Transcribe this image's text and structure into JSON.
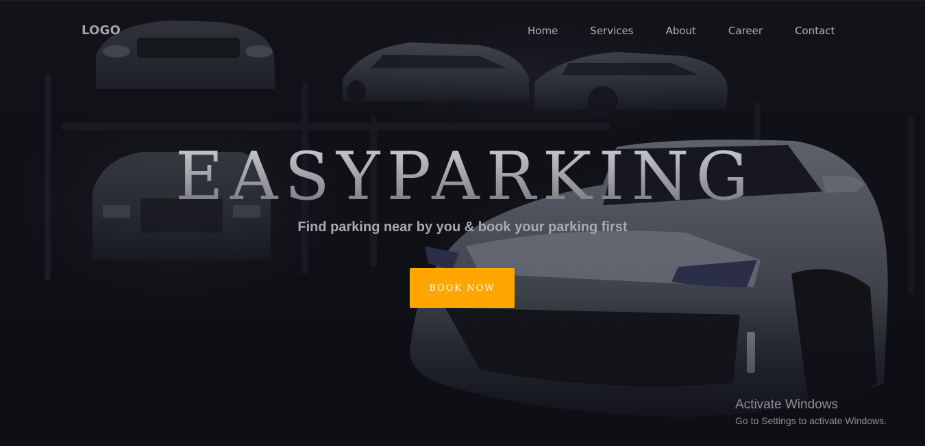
{
  "navbar": {
    "logo": "LOGO",
    "links": [
      {
        "label": "Home"
      },
      {
        "label": "Services"
      },
      {
        "label": "About"
      },
      {
        "label": "Career"
      },
      {
        "label": "Contact"
      }
    ]
  },
  "hero": {
    "title": "EASYPARKING",
    "subtitle": "Find parking near by you & book your parking first",
    "cta_label": "BOOK NOW",
    "background": "parking garage with cars on lifts and a silver sports car"
  },
  "system_watermark": {
    "title": "Activate Windows",
    "subtitle": "Go to Settings to activate Windows."
  },
  "colors": {
    "accent": "#ffa600",
    "background": "#101117",
    "nav_text": "#b1b2b7"
  }
}
